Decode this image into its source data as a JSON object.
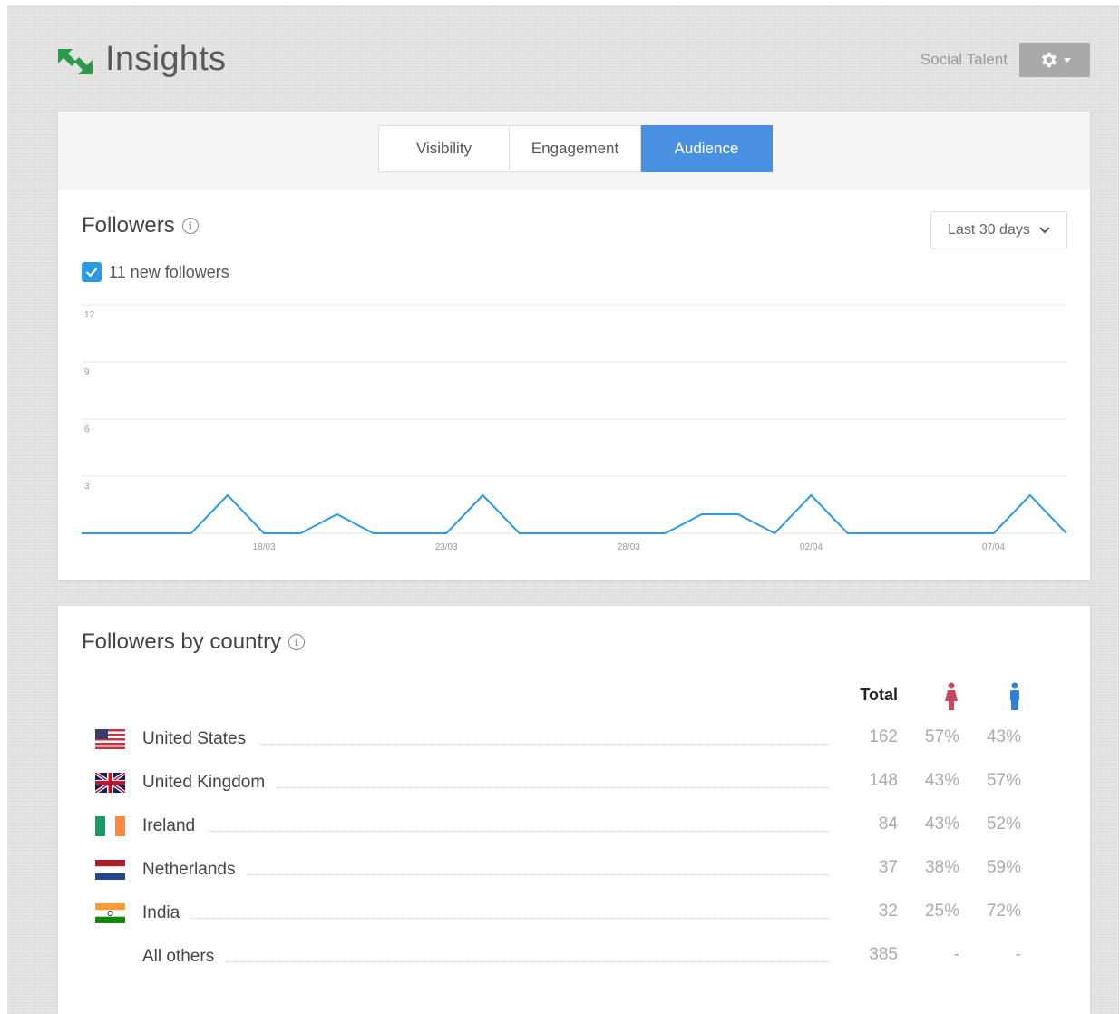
{
  "header": {
    "app_title": "Insights",
    "user_name": "Social Talent",
    "logo_icon": "arrows-exchange-icon",
    "settings_icon": "gear-icon",
    "brand_color": "#2a9a4a"
  },
  "tabs": [
    {
      "label": "Visibility",
      "active": false
    },
    {
      "label": "Engagement",
      "active": false
    },
    {
      "label": "Audience",
      "active": true
    }
  ],
  "followers": {
    "title": "Followers",
    "date_range": "Last 30 days",
    "legend": "11 new followers",
    "accent_color": "#2b9ae6"
  },
  "chart_data": {
    "type": "line",
    "title": "",
    "xlabel": "",
    "ylabel": "",
    "ylim": [
      0,
      12
    ],
    "yticks": [
      "12",
      "9",
      "6",
      "3"
    ],
    "xtick_labels": [
      "18/03",
      "23/03",
      "28/03",
      "02/04",
      "07/04"
    ],
    "grid": true,
    "series": [
      {
        "name": "",
        "color": "#2b9ae6",
        "values": [
          0,
          0,
          0,
          0,
          2,
          0,
          0,
          1,
          0,
          0,
          0,
          2,
          0,
          0,
          0,
          0,
          0,
          1,
          1,
          0,
          2,
          0,
          0,
          0,
          0,
          0,
          2,
          0
        ]
      }
    ]
  },
  "by_country": {
    "title": "Followers by country",
    "headers": {
      "total": "Total",
      "female_icon": "female-icon",
      "male_icon": "male-icon",
      "female_color": "#c2495e",
      "male_color": "#2f7fd8"
    },
    "rows": [
      {
        "flag": "us-flag-icon",
        "country": "United States",
        "total": "162",
        "female": "57%",
        "male": "43%"
      },
      {
        "flag": "uk-flag-icon",
        "country": "United Kingdom",
        "total": "148",
        "female": "43%",
        "male": "57%"
      },
      {
        "flag": "ie-flag-icon",
        "country": "Ireland",
        "total": "84",
        "female": "43%",
        "male": "52%"
      },
      {
        "flag": "nl-flag-icon",
        "country": "Netherlands",
        "total": "37",
        "female": "38%",
        "male": "59%"
      },
      {
        "flag": "in-flag-icon",
        "country": "India",
        "total": "32",
        "female": "25%",
        "male": "72%"
      },
      {
        "flag": "",
        "country": "All others",
        "total": "385",
        "female": "-",
        "male": "-"
      }
    ]
  }
}
